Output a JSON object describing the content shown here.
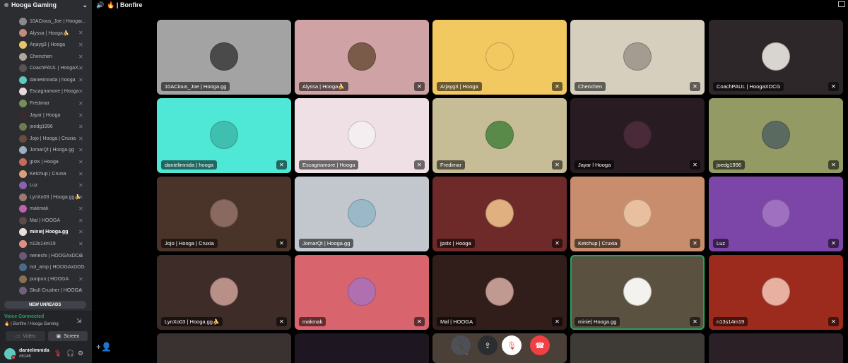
{
  "guild": {
    "name": "Hooga Gaming",
    "chevron": "⌄"
  },
  "channel": {
    "title": "🔥 | Bonfire",
    "speaker_icon": "🔊"
  },
  "members": [
    {
      "name": "10ACious_Joe | Hooga.gg",
      "color": "#8a8a8a"
    },
    {
      "name": "Alyssa | Hooga🍌",
      "color": "#c48a7a"
    },
    {
      "name": "Arjayg3 | Hooga",
      "color": "#e8c46a"
    },
    {
      "name": "Chenchen",
      "color": "#b0a897"
    },
    {
      "name": "CoachPAUL | HoogaXDCG",
      "color": "#5a5352"
    },
    {
      "name": "danielimnida | hooga",
      "color": "#5ec9be"
    },
    {
      "name": "Escagriamore | Hooga",
      "color": "#e6d8db"
    },
    {
      "name": "Fredimar",
      "color": "#7a8c5a"
    },
    {
      "name": "Jayar | Hooga",
      "color": "#3a2a30"
    },
    {
      "name": "joedg1996",
      "color": "#6f7a50"
    },
    {
      "name": "Jojo | Hooga | Cruxia",
      "color": "#6b4a42"
    },
    {
      "name": "JomarQt | Hooga.gg",
      "color": "#9ab0c0"
    },
    {
      "name": "jpstx | Hooga",
      "color": "#c86a5a"
    },
    {
      "name": "Ketchup | Cruxia",
      "color": "#d9a078"
    },
    {
      "name": "Luz",
      "color": "#8a60b0"
    },
    {
      "name": "LynXo03 | Hooga.gg🍌",
      "color": "#9a7a70"
    },
    {
      "name": "makmak",
      "color": "#c060b0"
    },
    {
      "name": "Mal | HOOGA",
      "color": "#5a4a48"
    },
    {
      "name": "minie| Hooga.gg",
      "color": "#e6e0d8",
      "active": true
    },
    {
      "name": "n13s14m19",
      "color": "#e09080"
    },
    {
      "name": "nenechi | HOOGAxDCG",
      "color": "#6a5a7a"
    },
    {
      "name": "nol_amp | HOOGAxDCG",
      "color": "#4a6a8a"
    },
    {
      "name": "punpun | HOOGA",
      "color": "#8a7050"
    },
    {
      "name": "Skull Crusher | HOOGA",
      "color": "#70607a"
    }
  ],
  "sidebar": {
    "new_unreads": "NEW UNREADS",
    "voice_status": "Voice Connected",
    "voice_channel": "🔥 | Bonfire / Hooga Gaming",
    "video_label": "Video",
    "screen_label": "Screen"
  },
  "user": {
    "name": "danielimnida",
    "tag": "#6146"
  },
  "tiles": [
    {
      "name": "10ACious_Joe | Hooga.gg",
      "bg": "#a3a3a3",
      "av": "#4a4a4a",
      "muted": false
    },
    {
      "name": "Alyssa | Hooga🍌",
      "bg": "#cfa3a5",
      "av": "#7a5a48",
      "muted": true
    },
    {
      "name": "Arjayg3 | Hooga",
      "bg": "#f2c860",
      "av": "#f2c860",
      "muted": true
    },
    {
      "name": "Chenchen",
      "bg": "#d6cfbe",
      "av": "#a49c90",
      "muted": true
    },
    {
      "name": "CoachPAUL | HoogaXDCG",
      "bg": "#2d2729",
      "av": "#d8d4d0",
      "muted": true
    },
    {
      "name": "danielimnida | hooga",
      "bg": "#4fe7d6",
      "av": "#3fbfb0",
      "muted": true
    },
    {
      "name": "Escagriamore | Hooga",
      "bg": "#eee0e5",
      "av": "#f4eef0",
      "muted": true
    },
    {
      "name": "Fredimar",
      "bg": "#c6bc96",
      "av": "#5a8a4a",
      "muted": true
    },
    {
      "name": "Jayar l Hooga",
      "bg": "#281c22",
      "av": "#4a2a38",
      "muted": true
    },
    {
      "name": "joedg1996",
      "bg": "#939a64",
      "av": "#5a6a60",
      "muted": true
    },
    {
      "name": "Jojo | Hooga | Cruxia",
      "bg": "#4a342a",
      "av": "#8a6a60",
      "muted": true
    },
    {
      "name": "JomarQt | Hooga.gg",
      "bg": "#c1c7cc",
      "av": "#9ab8c8",
      "muted": false
    },
    {
      "name": "jpstx | Hooga",
      "bg": "#6d2a28",
      "av": "#e0b080",
      "muted": true
    },
    {
      "name": "Ketchup | Cruxia",
      "bg": "#c88d6c",
      "av": "#e8c0a0",
      "muted": true
    },
    {
      "name": "Luz",
      "bg": "#7c46a9",
      "av": "#a070c0",
      "muted": true
    },
    {
      "name": "LynXo03 | Hooga.gg🍌",
      "bg": "#3d2c28",
      "av": "#b89088",
      "muted": true
    },
    {
      "name": "makmak",
      "bg": "#d8646e",
      "av": "#b070b0",
      "muted": true
    },
    {
      "name": "Mal | HOOGA",
      "bg": "#311e1b",
      "av": "#c09a90",
      "muted": true
    },
    {
      "name": "minie| Hooga.gg",
      "bg": "#5a5140",
      "av": "#f4f2ee",
      "muted": true,
      "speaking": true
    },
    {
      "name": "n13s14m19",
      "bg": "#9c2a1d",
      "av": "#e8b0a0",
      "muted": true
    }
  ],
  "controls": {
    "camera_icon": "🎥",
    "share_icon": "⇪",
    "mute_icon": "🎙",
    "leave_icon": "☎"
  }
}
